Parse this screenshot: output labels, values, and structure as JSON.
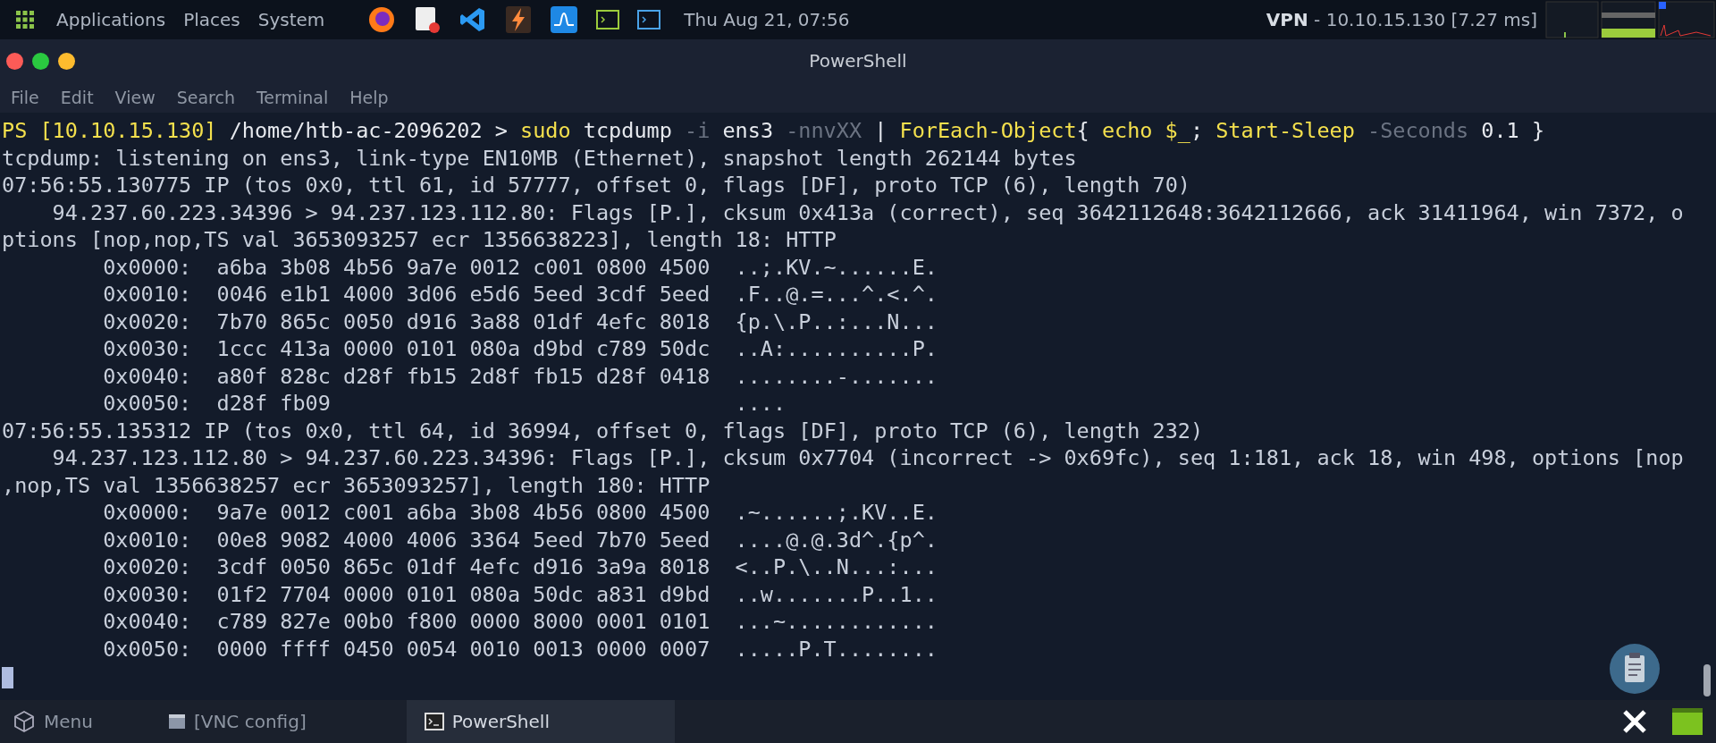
{
  "top_panel": {
    "menus": [
      "Applications",
      "Places",
      "System"
    ],
    "clock": "Thu Aug 21, 07:56",
    "vpn": "**VPN** - 10.10.15.130 [7.27 ms]"
  },
  "window": {
    "title": "PowerShell"
  },
  "menu_bar": [
    "File",
    "Edit",
    "View",
    "Search",
    "Terminal",
    "Help"
  ],
  "terminal": {
    "prompt": [
      {
        "kind": "prompt",
        "text": "PS [10.10.15.130]"
      },
      {
        "kind": "plain",
        "text": "/home/htb-ac-2096202 >"
      },
      {
        "kind": "command",
        "text": "sudo"
      },
      {
        "kind": "plain",
        "text": "tcpdump"
      },
      {
        "kind": "parameter",
        "text": "-i"
      },
      {
        "kind": "plain",
        "text": "ens3"
      },
      {
        "kind": "parameter",
        "text": "-nnvXX"
      },
      {
        "kind": "plain",
        "text": "|"
      },
      {
        "kind": "command",
        "text": "ForEach-Object"
      },
      {
        "kind": "plain",
        "text": "{"
      },
      {
        "kind": "command",
        "text": "echo"
      },
      {
        "kind": "command",
        "text": "$_"
      },
      {
        "kind": "plain",
        "text": ";"
      },
      {
        "kind": "command",
        "text": "Start-Sleep"
      },
      {
        "kind": "parameter",
        "text": "-Seconds"
      },
      {
        "kind": "plain",
        "text": "0.1 }"
      }
    ],
    "lines": [
      {
        "kind": "text",
        "text": "tcpdump: listening on ens3, link-type EN10MB (Ethernet), snapshot length 262144 bytes"
      },
      {
        "kind": "text",
        "text": "07:56:55.130775 IP (tos 0x0, ttl 61, id 57777, offset 0, flags [DF], proto TCP (6), length 70)"
      },
      {
        "kind": "detail",
        "text": "94.237.60.223.34396 > 94.237.123.112.80: Flags [P.], cksum 0x413a (correct), seq 3642112648:3642112666, ack 31411964, win 7372, o"
      },
      {
        "kind": "text",
        "text": "ptions [nop,nop,TS val 3653093257 ecr 1356638223], length 18: HTTP"
      },
      {
        "kind": "hex",
        "offset": "0x0000:",
        "hex": "a6ba 3b08 4b56 9a7e 0012 c001 0800 4500",
        "ascii": "..;.KV.~......E."
      },
      {
        "kind": "hex",
        "offset": "0x0010:",
        "hex": "0046 e1b1 4000 3d06 e5d6 5eed 3cdf 5eed",
        "ascii": ".F..@.=...^.<.^."
      },
      {
        "kind": "hex",
        "offset": "0x0020:",
        "hex": "7b70 865c 0050 d916 3a88 01df 4efc 8018",
        "ascii": "{p.\\.P..:...N..."
      },
      {
        "kind": "hex",
        "offset": "0x0030:",
        "hex": "1ccc 413a 0000 0101 080a d9bd c789 50dc",
        "ascii": "..A:..........P."
      },
      {
        "kind": "hex",
        "offset": "0x0040:",
        "hex": "a80f 828c d28f fb15 2d8f fb15 d28f 0418",
        "ascii": "........-......."
      },
      {
        "kind": "hex",
        "offset": "0x0050:",
        "hex": "d28f fb09",
        "ascii": "...."
      },
      {
        "kind": "text",
        "text": "07:56:55.135312 IP (tos 0x0, ttl 64, id 36994, offset 0, flags [DF], proto TCP (6), length 232)"
      },
      {
        "kind": "detail",
        "text": "94.237.123.112.80 > 94.237.60.223.34396: Flags [P.], cksum 0x7704 (incorrect -> 0x69fc), seq 1:181, ack 18, win 498, options [nop"
      },
      {
        "kind": "text",
        "text": ",nop,TS val 1356638257 ecr 3653093257], length 180: HTTP"
      },
      {
        "kind": "hex",
        "offset": "0x0000:",
        "hex": "9a7e 0012 c001 a6ba 3b08 4b56 0800 4500",
        "ascii": ".~......;.KV..E."
      },
      {
        "kind": "hex",
        "offset": "0x0010:",
        "hex": "00e8 9082 4000 4006 3364 5eed 7b70 5eed",
        "ascii": "....@.@.3d^.{p^."
      },
      {
        "kind": "hex",
        "offset": "0x0020:",
        "hex": "3cdf 0050 865c 01df 4efc d916 3a9a 8018",
        "ascii": "<..P.\\..N...:..."
      },
      {
        "kind": "hex",
        "offset": "0x0030:",
        "hex": "01f2 7704 0000 0101 080a 50dc a831 d9bd",
        "ascii": "..w.......P..1.."
      },
      {
        "kind": "hex",
        "offset": "0x0040:",
        "hex": "c789 827e 00b0 f800 0000 8000 0001 0101",
        "ascii": "...~............"
      },
      {
        "kind": "hex",
        "offset": "0x0050:",
        "hex": "0000 ffff 0450 0054 0010 0013 0000 0007",
        "ascii": ".....P.T........"
      }
    ]
  },
  "taskbar": [
    {
      "label": "Menu",
      "kind": "menu",
      "selected": false
    },
    {
      "label": "[VNC config]",
      "kind": "window",
      "selected": false
    },
    {
      "label": "PowerShell",
      "kind": "terminal",
      "selected": true
    }
  ]
}
